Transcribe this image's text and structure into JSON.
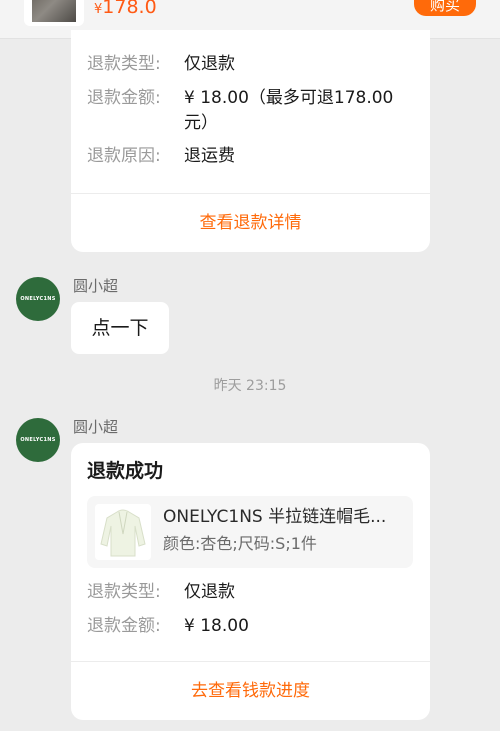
{
  "top_bar": {
    "price_symbol": "¥",
    "price": "178.0",
    "buy_label": "购买"
  },
  "refund_card_1": {
    "rows": [
      {
        "label": "退款类型:",
        "value": "仅退款"
      },
      {
        "label": "退款金额:",
        "value_line1": "¥ 18.00（最多可退178.00",
        "value_line2": "元）"
      },
      {
        "label": "退款原因:",
        "value": "退运费"
      }
    ],
    "link_label": "查看退款详情"
  },
  "message_1": {
    "sender": "圆小超",
    "avatar_text": "ONELYC1NS",
    "text": "点一下"
  },
  "timestamp": "昨天 23:15",
  "message_2": {
    "sender": "圆小超",
    "avatar_text": "ONELYC1NS"
  },
  "refund_card_2": {
    "title": "退款成功",
    "product": {
      "name": "ONELYC1NS 半拉链连帽毛...",
      "spec": "颜色:杏色;尺码:S;1件"
    },
    "rows": [
      {
        "label": "退款类型:",
        "value": "仅退款"
      },
      {
        "label": "退款金额:",
        "value": "¥ 18.00"
      }
    ],
    "link_label": "去查看钱款进度"
  },
  "colors": {
    "accent": "#ff6a0a",
    "avatar_bg": "#2e6b3b",
    "background": "#ececec"
  }
}
